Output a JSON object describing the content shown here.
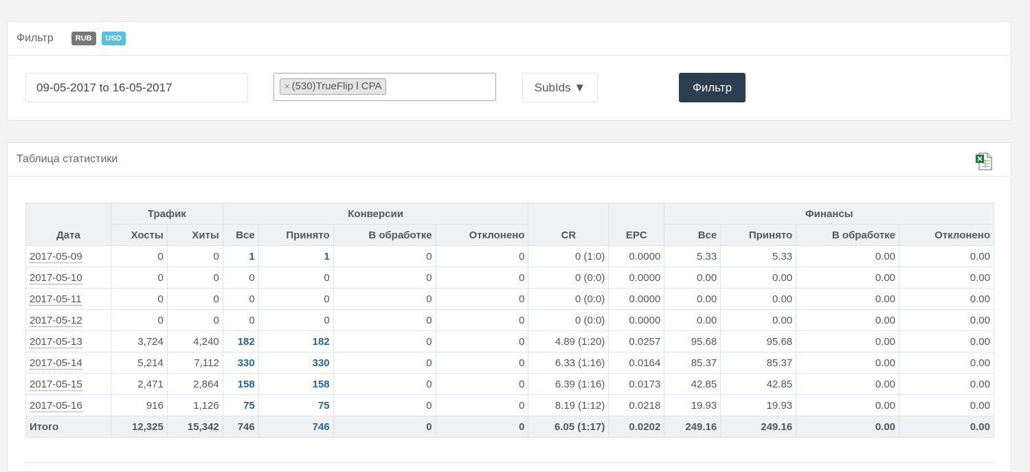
{
  "filter": {
    "title": "Фильтр",
    "currencies": [
      {
        "label": "RUB",
        "color": "#777777"
      },
      {
        "label": "USD",
        "color": "#5bc0de"
      }
    ],
    "date_range": "09-05-2017 to 16-05-2017",
    "offer_tag": "(530)TrueFlip l CPA",
    "offer_tag_remove": "×",
    "subids_label": "SubIds ▼",
    "button_label": "Фильтр",
    "button_color": "#2c3e50"
  },
  "stats": {
    "title": "Таблица статистики",
    "export_icon": "excel-export-icon",
    "group_headers": {
      "traffic": "Трафик",
      "conversions": "Конверсии",
      "finance": "Финансы"
    },
    "columns": {
      "date": "Дата",
      "hosts": "Хосты",
      "hits": "Хиты",
      "conv_all": "Все",
      "conv_accepted": "Принято",
      "conv_pending": "В обработке",
      "conv_rejected": "Отклонено",
      "cr": "CR",
      "epc": "EPC",
      "fin_all": "Все",
      "fin_accepted": "Принято",
      "fin_pending": "В обработке",
      "fin_rejected": "Отклонено"
    },
    "rows": [
      {
        "date": "2017-05-09",
        "hosts": "0",
        "hits": "0",
        "conv_all": "1",
        "conv_accepted": "1",
        "conv_pending": "0",
        "conv_rejected": "0",
        "cr": "0 (1:0)",
        "epc": "0.0000",
        "fin_all": "5.33",
        "fin_accepted": "5.33",
        "fin_pending": "0.00",
        "fin_rejected": "0.00"
      },
      {
        "date": "2017-05-10",
        "hosts": "0",
        "hits": "0",
        "conv_all": "0",
        "conv_accepted": "0",
        "conv_pending": "0",
        "conv_rejected": "0",
        "cr": "0 (0:0)",
        "epc": "0.0000",
        "fin_all": "0.00",
        "fin_accepted": "0.00",
        "fin_pending": "0.00",
        "fin_rejected": "0.00"
      },
      {
        "date": "2017-05-11",
        "hosts": "0",
        "hits": "0",
        "conv_all": "0",
        "conv_accepted": "0",
        "conv_pending": "0",
        "conv_rejected": "0",
        "cr": "0 (0:0)",
        "epc": "0.0000",
        "fin_all": "0.00",
        "fin_accepted": "0.00",
        "fin_pending": "0.00",
        "fin_rejected": "0.00"
      },
      {
        "date": "2017-05-12",
        "hosts": "0",
        "hits": "0",
        "conv_all": "0",
        "conv_accepted": "0",
        "conv_pending": "0",
        "conv_rejected": "0",
        "cr": "0 (0:0)",
        "epc": "0.0000",
        "fin_all": "0.00",
        "fin_accepted": "0.00",
        "fin_pending": "0.00",
        "fin_rejected": "0.00"
      },
      {
        "date": "2017-05-13",
        "hosts": "3,724",
        "hits": "4,240",
        "conv_all": "182",
        "conv_accepted": "182",
        "conv_pending": "0",
        "conv_rejected": "0",
        "cr": "4.89 (1:20)",
        "epc": "0.0257",
        "fin_all": "95.68",
        "fin_accepted": "95.68",
        "fin_pending": "0.00",
        "fin_rejected": "0.00"
      },
      {
        "date": "2017-05-14",
        "hosts": "5,214",
        "hits": "7,112",
        "conv_all": "330",
        "conv_accepted": "330",
        "conv_pending": "0",
        "conv_rejected": "0",
        "cr": "6.33 (1:16)",
        "epc": "0.0164",
        "fin_all": "85.37",
        "fin_accepted": "85.37",
        "fin_pending": "0.00",
        "fin_rejected": "0.00"
      },
      {
        "date": "2017-05-15",
        "hosts": "2,471",
        "hits": "2,864",
        "conv_all": "158",
        "conv_accepted": "158",
        "conv_pending": "0",
        "conv_rejected": "0",
        "cr": "6.39 (1:16)",
        "epc": "0.0173",
        "fin_all": "42.85",
        "fin_accepted": "42.85",
        "fin_pending": "0.00",
        "fin_rejected": "0.00"
      },
      {
        "date": "2017-05-16",
        "hosts": "916",
        "hits": "1,126",
        "conv_all": "75",
        "conv_accepted": "75",
        "conv_pending": "0",
        "conv_rejected": "0",
        "cr": "8.19 (1:12)",
        "epc": "0.0218",
        "fin_all": "19.93",
        "fin_accepted": "19.93",
        "fin_pending": "0.00",
        "fin_rejected": "0.00"
      }
    ],
    "total": {
      "date": "Итого",
      "hosts": "12,325",
      "hits": "15,342",
      "conv_all": "746",
      "conv_accepted": "746",
      "conv_pending": "0",
      "conv_rejected": "0",
      "cr": "6.05 (1:17)",
      "epc": "0.0202",
      "fin_all": "249.16",
      "fin_accepted": "249.16",
      "fin_pending": "0.00",
      "fin_rejected": "0.00"
    }
  }
}
